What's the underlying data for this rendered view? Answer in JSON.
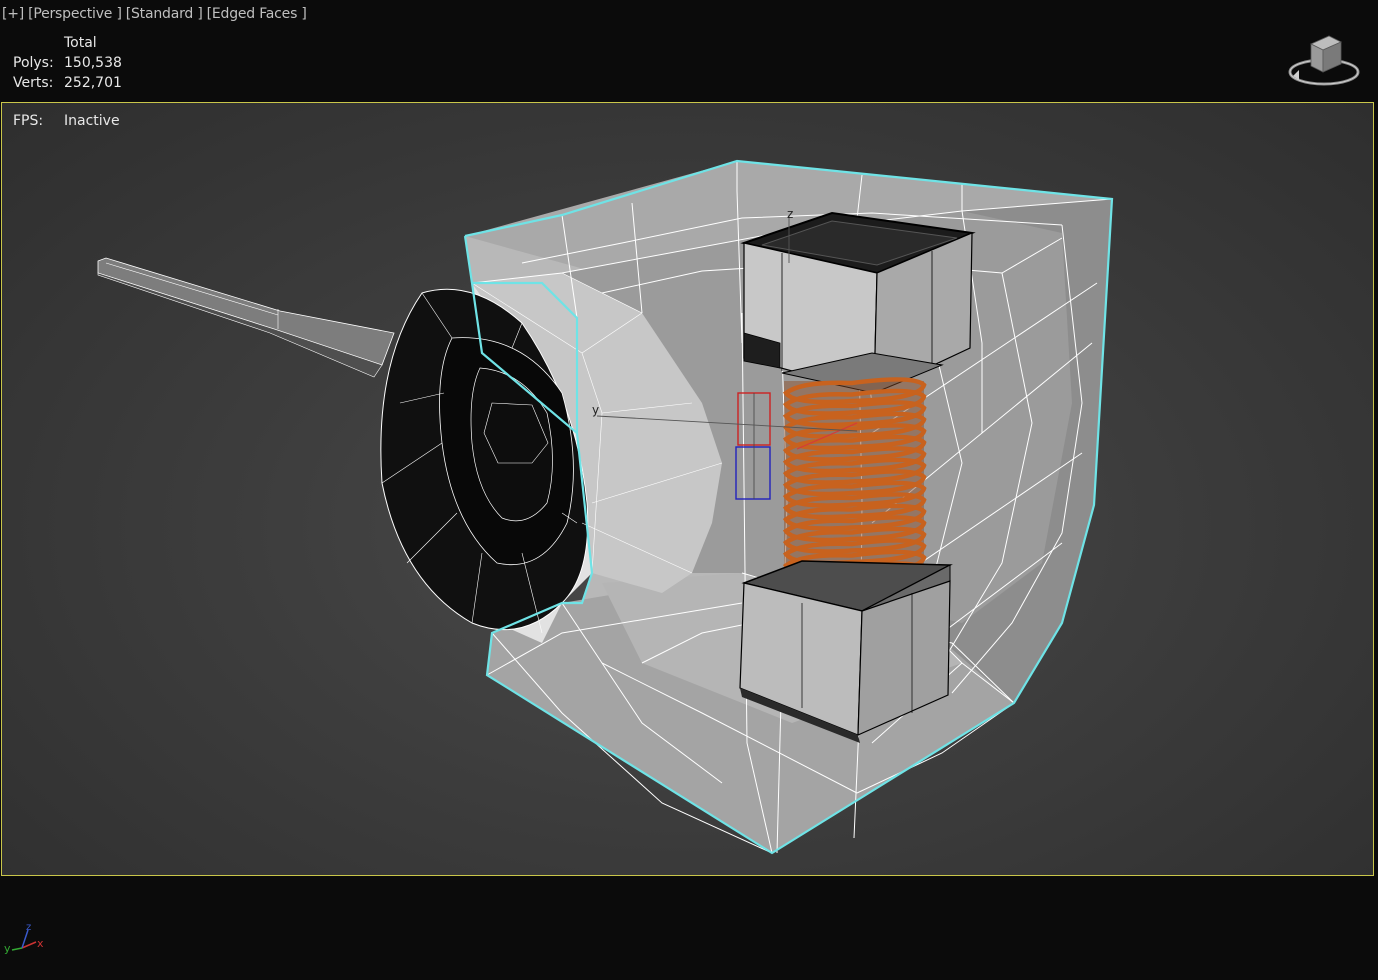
{
  "viewport": {
    "label_plus": "[+]",
    "label_view": "[Perspective ]",
    "label_shading": "[Standard ]",
    "label_mode": "[Edged Faces ]"
  },
  "stats": {
    "header": "Total",
    "polys_label": "Polys:",
    "polys_value": "150,538",
    "verts_label": "Verts:",
    "verts_value": "252,701",
    "fps_label": "FPS:",
    "fps_value": "Inactive"
  },
  "scene": {
    "gizmo_axis_y": "y",
    "gizmo_axis_z": "z"
  },
  "axis_tripod": {
    "x": "x",
    "y": "y",
    "z": "z"
  },
  "colors": {
    "viewport_border": "#c9c64a",
    "selection_outline": "#6fe3e6",
    "coil": "#c8621e",
    "wire": "#ffffff"
  }
}
